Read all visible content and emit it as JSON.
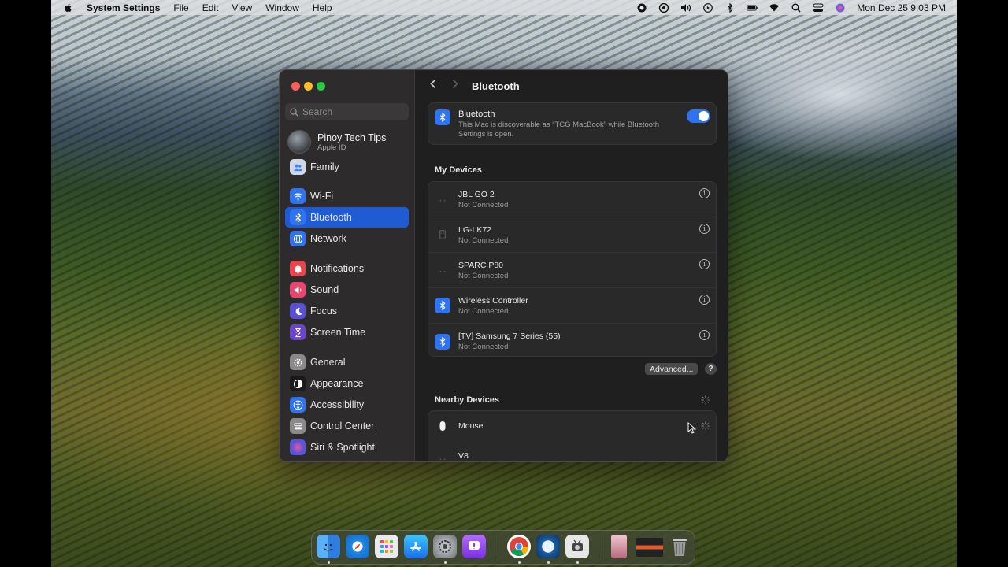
{
  "menubar": {
    "app_name": "System Settings",
    "menus": [
      "File",
      "Edit",
      "View",
      "Window",
      "Help"
    ],
    "clock": "Mon Dec 25  9:03 PM"
  },
  "sidebar": {
    "search_placeholder": "Search",
    "account": {
      "name": "Pinoy Tech Tips",
      "sub": "Apple ID"
    },
    "items": [
      {
        "label": "Family",
        "icon": "family-icon",
        "color": "#3b82f6"
      },
      {
        "label": "Wi-Fi",
        "icon": "wifi-icon",
        "color": "#2f73f0"
      },
      {
        "label": "Bluetooth",
        "icon": "bluetooth-icon",
        "color": "#2f73f0"
      },
      {
        "label": "Network",
        "icon": "globe-icon",
        "color": "#2f73f0"
      },
      {
        "label": "Notifications",
        "icon": "bell-icon",
        "color": "#e8464b"
      },
      {
        "label": "Sound",
        "icon": "speaker-icon",
        "color": "#e8456f"
      },
      {
        "label": "Focus",
        "icon": "moon-icon",
        "color": "#5b4fd6"
      },
      {
        "label": "Screen Time",
        "icon": "hourglass-icon",
        "color": "#6c44c9"
      },
      {
        "label": "General",
        "icon": "gear-icon",
        "color": "#8a8a8a"
      },
      {
        "label": "Appearance",
        "icon": "appearance-icon",
        "color": "#1a1a1a"
      },
      {
        "label": "Accessibility",
        "icon": "accessibility-icon",
        "color": "#2f73f0"
      },
      {
        "label": "Control Center",
        "icon": "control-center-icon",
        "color": "#8a8a8a"
      },
      {
        "label": "Siri & Spotlight",
        "icon": "siri-icon",
        "color": "#7a3fc9"
      }
    ]
  },
  "content": {
    "title": "Bluetooth",
    "bluetooth": {
      "label": "Bluetooth",
      "description": "This Mac is discoverable as “TCG MacBook” while Bluetooth Settings is open.",
      "enabled": true
    },
    "my_devices_title": "My Devices",
    "my_devices": [
      {
        "name": "JBL GO 2",
        "status": "Not Connected",
        "icon": "speaker-device-icon"
      },
      {
        "name": "LG-LK72",
        "status": "Not Connected",
        "icon": "speaker-device-icon"
      },
      {
        "name": "SPARC P80",
        "status": "Not Connected",
        "icon": "speaker-device-icon"
      },
      {
        "name": "Wireless Controller",
        "status": "Not Connected",
        "icon": "bluetooth-icon"
      },
      {
        "name": "[TV] Samsung 7 Series (55)",
        "status": "Not Connected",
        "icon": "bluetooth-icon"
      }
    ],
    "advanced_label": "Advanced...",
    "help_label": "?",
    "nearby_title": "Nearby Devices",
    "nearby_devices": [
      {
        "name": "Mouse",
        "icon": "mouse-icon"
      },
      {
        "name": "V8",
        "icon": "speaker-device-icon"
      }
    ]
  },
  "dock": {
    "apps": [
      "finder-icon",
      "safari-icon",
      "launchpad-icon",
      "app-store-icon",
      "system-settings-icon",
      "feedback-icon",
      "chrome-icon",
      "quicktime-icon",
      "screenshot-icon",
      "photo-thumb-icon",
      "video-thumb-icon",
      "trash-icon"
    ]
  }
}
